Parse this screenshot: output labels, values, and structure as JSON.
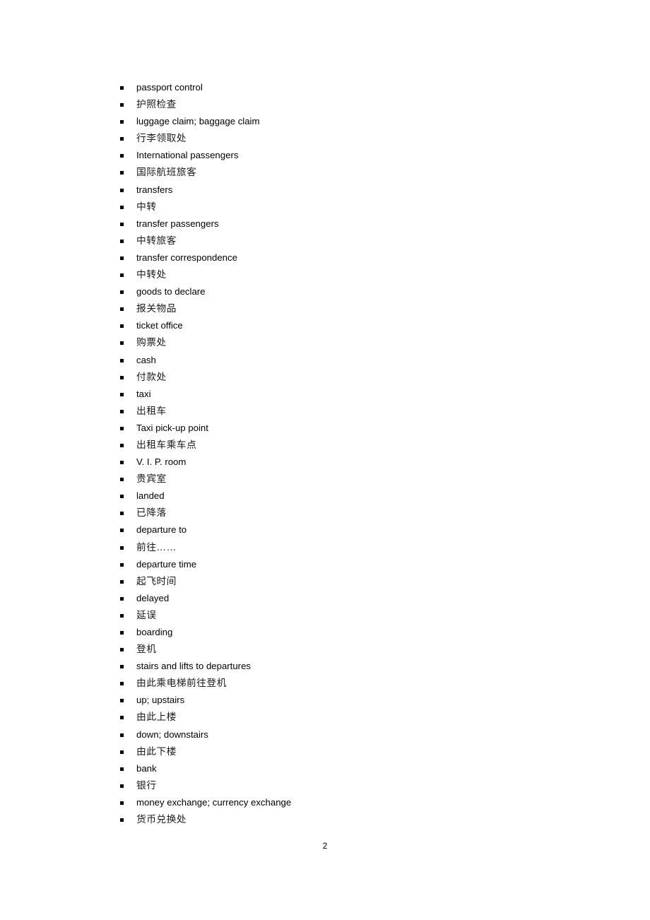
{
  "document": {
    "page_number": "2",
    "background_color": "#ffffff",
    "text_color": "#000000",
    "bullet_color": "#000000",
    "bullet_icon": "square-bullet-icon"
  },
  "list": {
    "items": [
      {
        "text": "passport control",
        "lang": "en"
      },
      {
        "text": "护照检查",
        "lang": "zh"
      },
      {
        "text": "luggage claim; baggage claim",
        "lang": "en"
      },
      {
        "text": "行李领取处",
        "lang": "zh"
      },
      {
        "text": "International passengers",
        "lang": "en"
      },
      {
        "text": "国际航班旅客",
        "lang": "zh"
      },
      {
        "text": "transfers",
        "lang": "en"
      },
      {
        "text": "中转",
        "lang": "zh"
      },
      {
        "text": "transfer passengers",
        "lang": "en"
      },
      {
        "text": "中转旅客",
        "lang": "zh"
      },
      {
        "text": "transfer correspondence",
        "lang": "en"
      },
      {
        "text": "中转处",
        "lang": "zh"
      },
      {
        "text": "goods to declare",
        "lang": "en"
      },
      {
        "text": "报关物品",
        "lang": "zh"
      },
      {
        "text": "ticket office",
        "lang": "en"
      },
      {
        "text": "购票处",
        "lang": "zh"
      },
      {
        "text": "cash",
        "lang": "en"
      },
      {
        "text": "付款处",
        "lang": "zh"
      },
      {
        "text": "taxi",
        "lang": "en"
      },
      {
        "text": "出租车",
        "lang": "zh"
      },
      {
        "text": "Taxi pick-up point",
        "lang": "en"
      },
      {
        "text": "出租车乘车点",
        "lang": "zh"
      },
      {
        "text": "V. I. P. room",
        "lang": "en"
      },
      {
        "text": "贵宾室",
        "lang": "zh"
      },
      {
        "text": "landed",
        "lang": "en"
      },
      {
        "text": "已降落",
        "lang": "zh"
      },
      {
        "text": "departure to",
        "lang": "en"
      },
      {
        "text": "前往……",
        "lang": "zh"
      },
      {
        "text": "departure time",
        "lang": "en"
      },
      {
        "text": "起飞时间",
        "lang": "zh"
      },
      {
        "text": "delayed",
        "lang": "en"
      },
      {
        "text": "延误",
        "lang": "zh"
      },
      {
        "text": "boarding",
        "lang": "en"
      },
      {
        "text": "登机",
        "lang": "zh"
      },
      {
        "text": "stairs and lifts to departures",
        "lang": "en"
      },
      {
        "text": "由此乘电梯前往登机",
        "lang": "zh"
      },
      {
        "text": "up; upstairs",
        "lang": "en"
      },
      {
        "text": "由此上楼",
        "lang": "zh"
      },
      {
        "text": "down; downstairs",
        "lang": "en"
      },
      {
        "text": "由此下楼",
        "lang": "zh"
      },
      {
        "text": "bank",
        "lang": "en"
      },
      {
        "text": "银行",
        "lang": "zh"
      },
      {
        "text": "money exchange; currency exchange",
        "lang": "en"
      },
      {
        "text": "货币兑换处",
        "lang": "zh"
      }
    ]
  }
}
